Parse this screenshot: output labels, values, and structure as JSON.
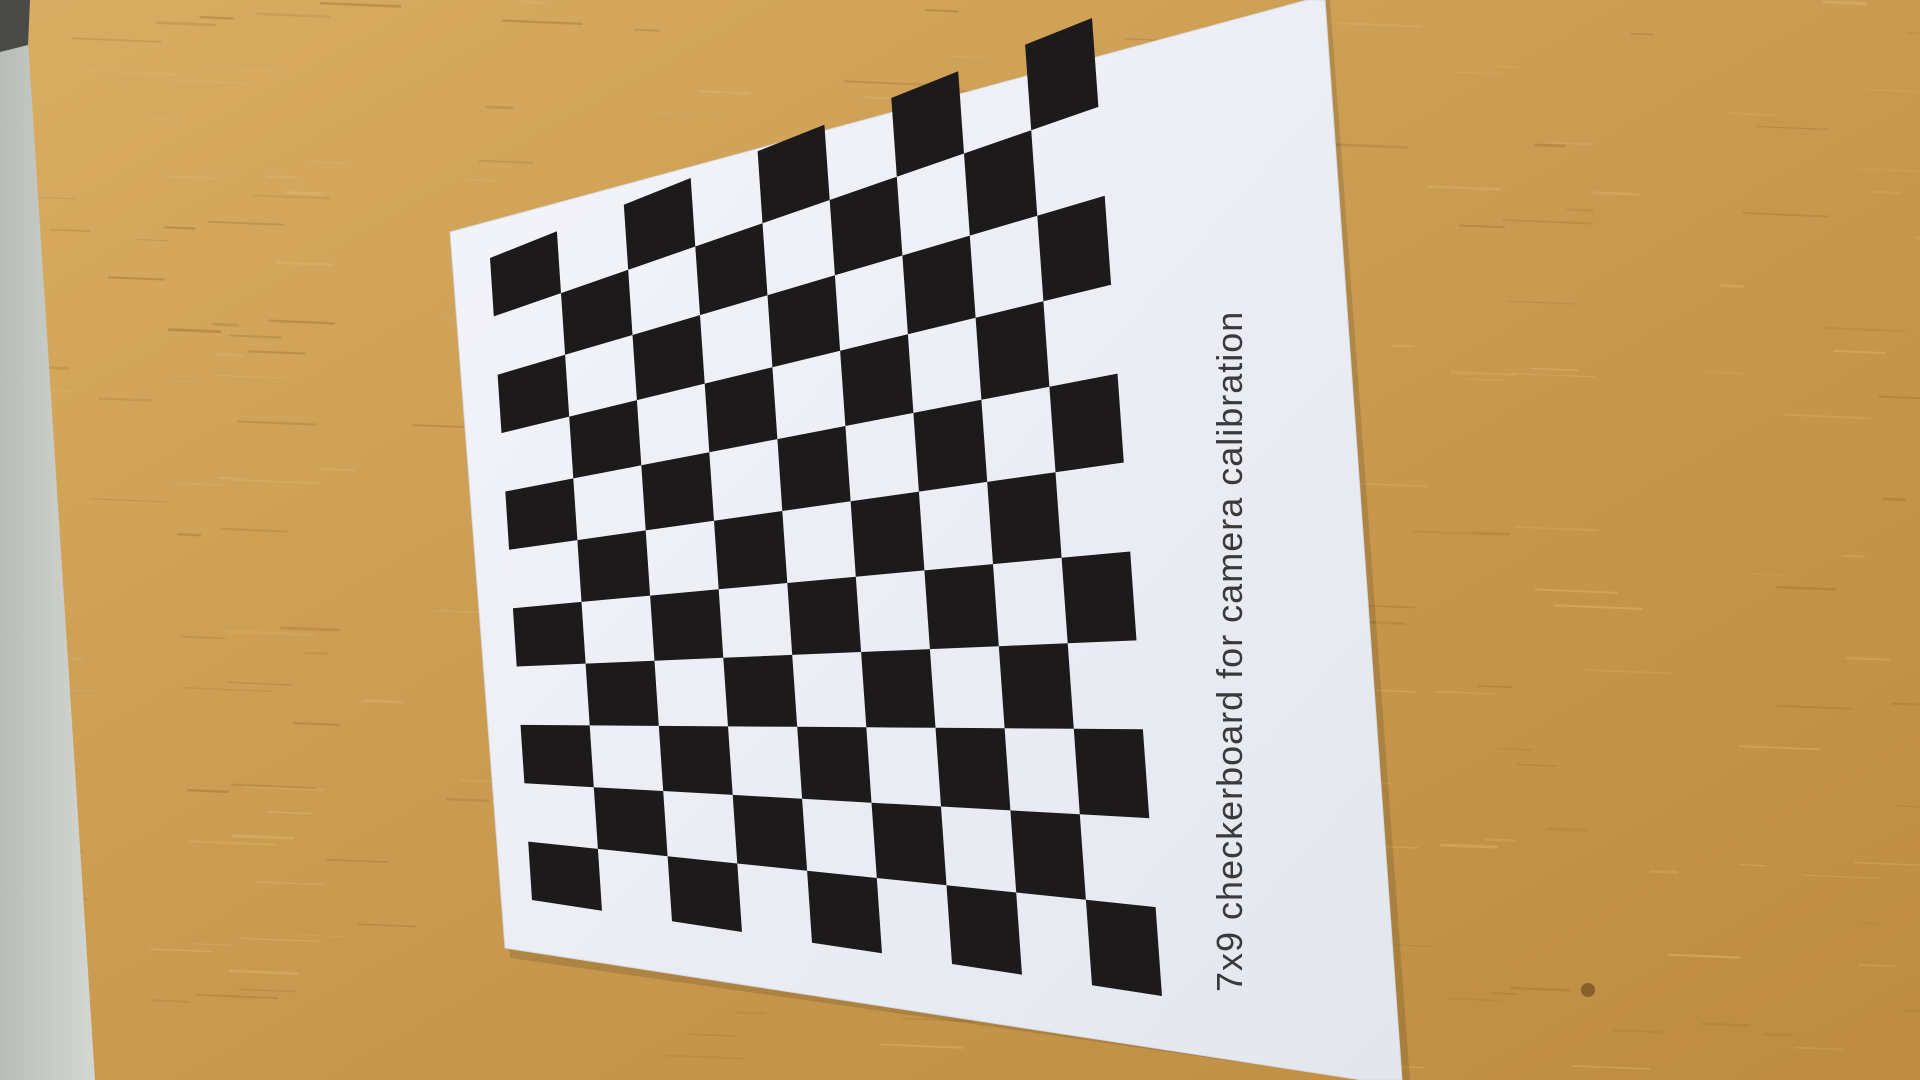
{
  "scene": {
    "description_free": true,
    "board": {
      "columns": 9,
      "rows": 11,
      "caption": "7x9 checkerboard for camera calibration"
    },
    "colors": {
      "desk": "#c89a4e",
      "desk_dark": "#a87a35",
      "desk_light": "#dcb46c",
      "paper": "#eef0f6",
      "square": "#1d1a1b",
      "caption": "#3a3a3c",
      "wall": "#c9ccc6"
    }
  }
}
